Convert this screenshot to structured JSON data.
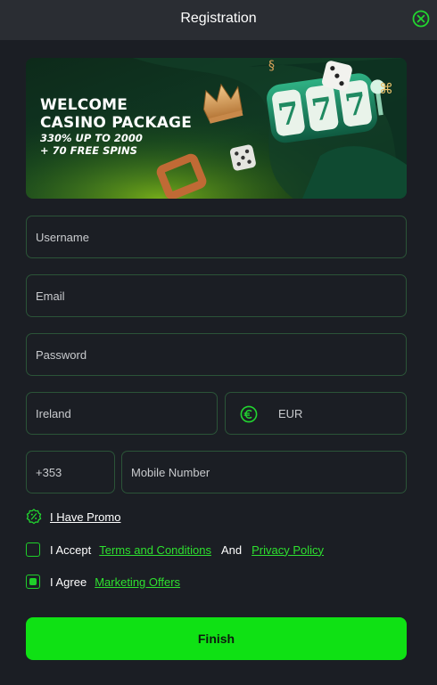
{
  "header": {
    "title": "Registration",
    "close_icon": "close-circle-icon"
  },
  "banner": {
    "headline_1": "WELCOME",
    "headline_2": "CASINO PACKAGE",
    "line_1": "330% UP TO 2000",
    "line_2": "+ 70 FREE SPINS",
    "slot_symbols": [
      "7",
      "7",
      "7"
    ]
  },
  "form": {
    "username_placeholder": "Username",
    "email_placeholder": "Email",
    "password_placeholder": "Password",
    "country_value": "Ireland",
    "currency_icon": "euro-icon",
    "currency_value": "EUR",
    "phone_code": "+353",
    "mobile_placeholder": "Mobile Number"
  },
  "promo": {
    "icon": "percent-badge-icon",
    "label": "I Have Promo"
  },
  "terms": {
    "prefix": "I Accept",
    "terms_link": "Terms and Conditions",
    "and_text": "And",
    "privacy_link": "Privacy Policy",
    "checked": false
  },
  "marketing": {
    "prefix": "I Agree",
    "link": "Marketing Offers",
    "checked": true
  },
  "finish_label": "Finish",
  "colors": {
    "accent": "#0fe114",
    "link": "#2ee02f",
    "field_border": "#2b5438",
    "background": "#1b1e24",
    "header": "#2a2d33"
  }
}
